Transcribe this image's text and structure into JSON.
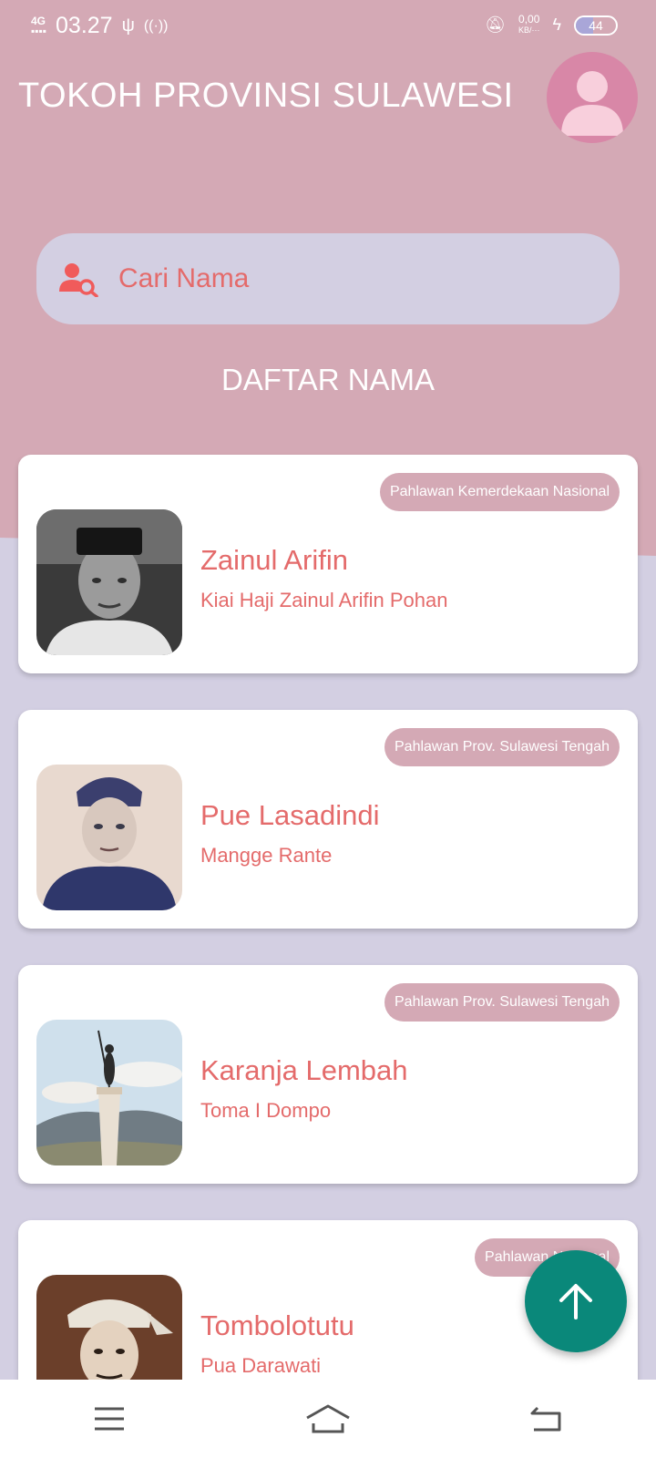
{
  "status_bar": {
    "network": "4G",
    "time": "03.27",
    "speed_value": "0,00",
    "speed_unit": "KB/···",
    "battery": "44",
    "battery_level": 0.44
  },
  "header": {
    "title": "TOKOH PROVINSI SULAWESI",
    "avatar_icon": "person-icon"
  },
  "search": {
    "placeholder": "Cari Nama",
    "icon": "user-search-icon"
  },
  "section_title": "DAFTAR NAMA",
  "cards": [
    {
      "badge": "Pahlawan Kemerdekaan Nasional",
      "name": "Zainul Arifin",
      "subtitle": "Kiai Haji Zainul Arifin Pohan"
    },
    {
      "badge": "Pahlawan Prov. Sulawesi Tengah",
      "name": "Pue Lasadindi",
      "subtitle": "Mangge Rante"
    },
    {
      "badge": "Pahlawan Prov. Sulawesi Tengah",
      "name": "Karanja Lembah",
      "subtitle": "Toma I Dompo"
    },
    {
      "badge": "Pahlawan Nasional",
      "name": "Tombolotutu",
      "subtitle": "Pua Darawati"
    }
  ],
  "fab": {
    "icon": "arrow-up-icon"
  },
  "nav": {
    "menu_icon": "menu-icon",
    "home_icon": "home-icon",
    "back_icon": "back-icon"
  },
  "colors": {
    "header_bg": "#d4a9b5",
    "page_bg": "#d3cfe2",
    "accent_text": "#e46b6b",
    "fab": "#0a887a",
    "avatar": "#d887a7"
  }
}
